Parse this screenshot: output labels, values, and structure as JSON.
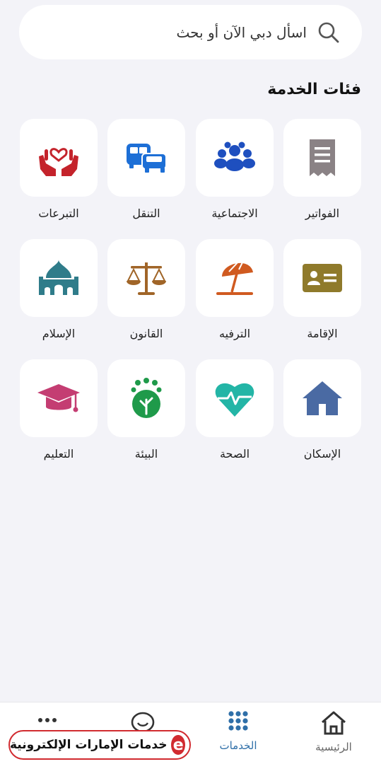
{
  "search": {
    "placeholder_text": "اسأل دبي الآن أو بحث"
  },
  "section": {
    "title": "فئات الخدمة"
  },
  "categories": [
    {
      "label": "الفواتير",
      "icon": "receipt-icon",
      "color": "#8a8285"
    },
    {
      "label": "الاجتماعية",
      "icon": "people-icon",
      "color": "#1e4fbf"
    },
    {
      "label": "التنقل",
      "icon": "vehicles-icon",
      "color": "#1d6fd6"
    },
    {
      "label": "التبرعات",
      "icon": "donation-hands-icon",
      "color": "#c4232b"
    },
    {
      "label": "الإقامة",
      "icon": "id-card-icon",
      "color": "#8f7a2b"
    },
    {
      "label": "الترفيه",
      "icon": "beach-umbrella-icon",
      "color": "#d05a20"
    },
    {
      "label": "القانون",
      "icon": "scales-icon",
      "color": "#a06528"
    },
    {
      "label": "الإسلام",
      "icon": "mosque-icon",
      "color": "#2f7c8a"
    },
    {
      "label": "الإسكان",
      "icon": "house-icon",
      "color": "#4a6aa3"
    },
    {
      "label": "الصحة",
      "icon": "heartbeat-icon",
      "color": "#23b5a6"
    },
    {
      "label": "البيئة",
      "icon": "tree-leaf-icon",
      "color": "#1f9a4a"
    },
    {
      "label": "التعليم",
      "icon": "graduation-cap-icon",
      "color": "#c43d72"
    }
  ],
  "nav": {
    "home": "الرئيسية",
    "services": "الخدمات"
  },
  "brand": {
    "text": "خدمات الإمارات الإلكترونية",
    "logo": "e"
  }
}
